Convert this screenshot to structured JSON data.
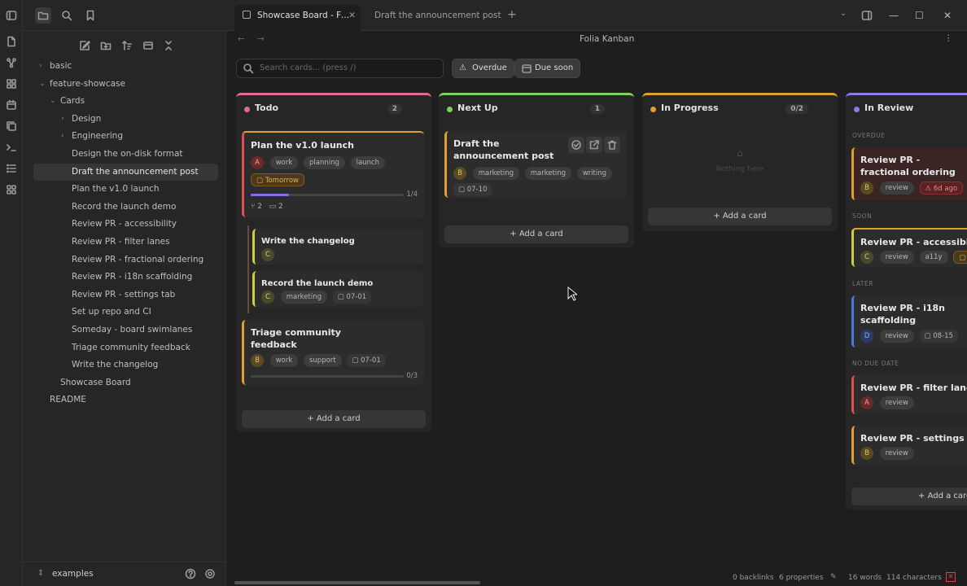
{
  "tabs": [
    {
      "label": "Showcase Board - Folia Kanban"
    },
    {
      "label": "Draft the announcement post"
    }
  ],
  "view_title": "Folia Kanban",
  "sidebar": {
    "tree": [
      {
        "label": "basic"
      },
      {
        "label": "feature-showcase"
      },
      {
        "label": "Cards"
      },
      {
        "label": "Design"
      },
      {
        "label": "Engineering"
      },
      {
        "label": "Design the on-disk format"
      },
      {
        "label": "Draft the announcement post"
      },
      {
        "label": "Plan the v1.0 launch"
      },
      {
        "label": "Record the launch demo"
      },
      {
        "label": "Review PR - accessibility"
      },
      {
        "label": "Review PR - filter lanes"
      },
      {
        "label": "Review PR - fractional ordering"
      },
      {
        "label": "Review PR - i18n scaffolding"
      },
      {
        "label": "Review PR - settings tab"
      },
      {
        "label": "Set up repo and CI"
      },
      {
        "label": "Someday - board swimlanes"
      },
      {
        "label": "Triage community feedback"
      },
      {
        "label": "Write the changelog"
      },
      {
        "label": "Showcase Board"
      },
      {
        "label": "README"
      }
    ],
    "vault": "examples"
  },
  "toolbar": {
    "search_placeholder": "Search cards... (press /)",
    "overdue": "Overdue",
    "due_soon": "Due soon"
  },
  "add_card": "Add a card",
  "empty_text": "Nothing here",
  "columns": [
    {
      "name": "Todo",
      "count": "2",
      "color": "#e06c8a",
      "cards": [
        {
          "title": "Plan the v1.0 launch",
          "avatar": "A",
          "tags": [
            "work",
            "planning",
            "launch"
          ],
          "due": "Tomorrow",
          "progress_text": "1/4",
          "progress": 0.25,
          "branches": "2",
          "comments": "2"
        },
        {
          "title": "Write the changelog",
          "avatar": "C"
        },
        {
          "title": "Record the launch demo",
          "avatar": "C",
          "tags": [
            "marketing"
          ],
          "due": "07-01"
        },
        {
          "title": "Triage community feedback",
          "avatar": "B",
          "tags": [
            "work",
            "support"
          ],
          "due": "07-01",
          "progress_text": "0/3",
          "progress": 0
        }
      ]
    },
    {
      "name": "Next Up",
      "count": "1",
      "color": "#7ad35a",
      "cards": [
        {
          "title": "Draft the announcement post",
          "avatar": "B",
          "tags": [
            "marketing",
            "marketing",
            "writing"
          ],
          "due": "07-10"
        }
      ]
    },
    {
      "name": "In Progress",
      "count": "0/2",
      "color": "#e0a030",
      "cards": []
    },
    {
      "name": "In Review",
      "count": "",
      "color": "#8a7ce6",
      "sections": [
        "OVERDUE",
        "SOON",
        "LATER",
        "NO DUE DATE"
      ],
      "cards": [
        {
          "title": "Review PR - fractional ordering",
          "avatar": "B",
          "tags": [
            "review"
          ],
          "due": "6d ago"
        },
        {
          "title": "Review PR - accessibility",
          "avatar": "C",
          "tags": [
            "review",
            "a11y"
          ]
        },
        {
          "title": "Review PR - i18n scaffolding",
          "avatar": "D",
          "tags": [
            "review"
          ],
          "due": "08-15"
        },
        {
          "title": "Review PR - filter lanes",
          "avatar": "A",
          "tags": [
            "review"
          ]
        },
        {
          "title": "Review PR - settings tab",
          "avatar": "B",
          "tags": [
            "review"
          ]
        }
      ]
    }
  ],
  "status": {
    "backlinks": "0 backlinks",
    "properties": "6 properties",
    "words": "16 words",
    "characters": "114 characters"
  }
}
